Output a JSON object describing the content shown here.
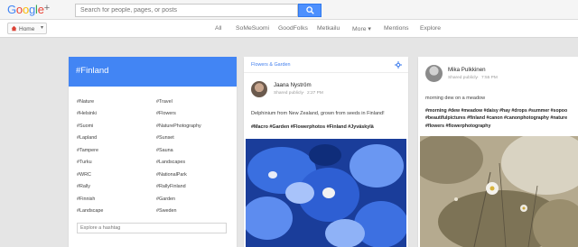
{
  "header": {
    "logo_letters": [
      "G",
      "o",
      "o",
      "g",
      "l",
      "e"
    ],
    "logo_plus": "+",
    "search_placeholder": "Search for people, pages, or posts",
    "search_button_icon": "search-icon",
    "colors": {
      "accent": "#4d90fe",
      "brand_blue": "#4285f4"
    }
  },
  "nav": {
    "home_label": "Home",
    "items": [
      "All",
      "SoMeSuomi",
      "GoodFolks",
      "Metkailu",
      "More",
      "Mentions",
      "Explore"
    ]
  },
  "hashtag_card": {
    "title": "#Finland",
    "header_color": "#4285f4",
    "left_tags": [
      "#Nature",
      "#Helsinki",
      "#Suomi",
      "#Lapland",
      "#Tampere",
      "#Turku",
      "#WRC",
      "#Rally",
      "#Finnish",
      "#Landscape"
    ],
    "right_tags": [
      "#Travel",
      "#Flowers",
      "#NaturePhotography",
      "#Sunset",
      "#Sauna",
      "#Landscapes",
      "#NationalPark",
      "#RallyFinland",
      "#Garden",
      "#Sweden"
    ],
    "explore_placeholder": "Explore a hashtag"
  },
  "post1": {
    "community": "Flowers & Garden",
    "author": "Jaana Nyström",
    "visibility": "Shared publicly",
    "time": "2:27 PM",
    "text": "Delphinium from New Zealand, grown from seeds in Finland!",
    "hashtags": "#Macro #Garden #Flowerphotos #Finland #Jyväskylä"
  },
  "post2": {
    "author": "Mika Pulkkinen",
    "visibility": "Shared publicly",
    "time": "7:55 PM",
    "text": "morning dew on a meadow",
    "hashtags": "#morning #dew #meadow #daisy #hay #drops #summer #sopoo #beautifulpictures #finland #canon #canonphotography #nature #flowers #flowerphotography"
  }
}
